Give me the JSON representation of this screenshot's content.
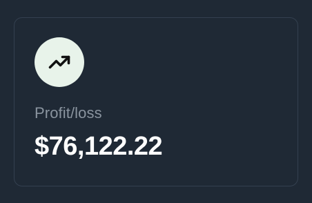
{
  "card": {
    "icon": "trending-up-icon",
    "label": "Profit/loss",
    "value": "$76,122.22"
  },
  "colors": {
    "background": "#1f2935",
    "card_border": "#344050",
    "icon_circle": "#e8f3ea",
    "label_text": "#8a949f",
    "value_text": "#ffffff"
  }
}
